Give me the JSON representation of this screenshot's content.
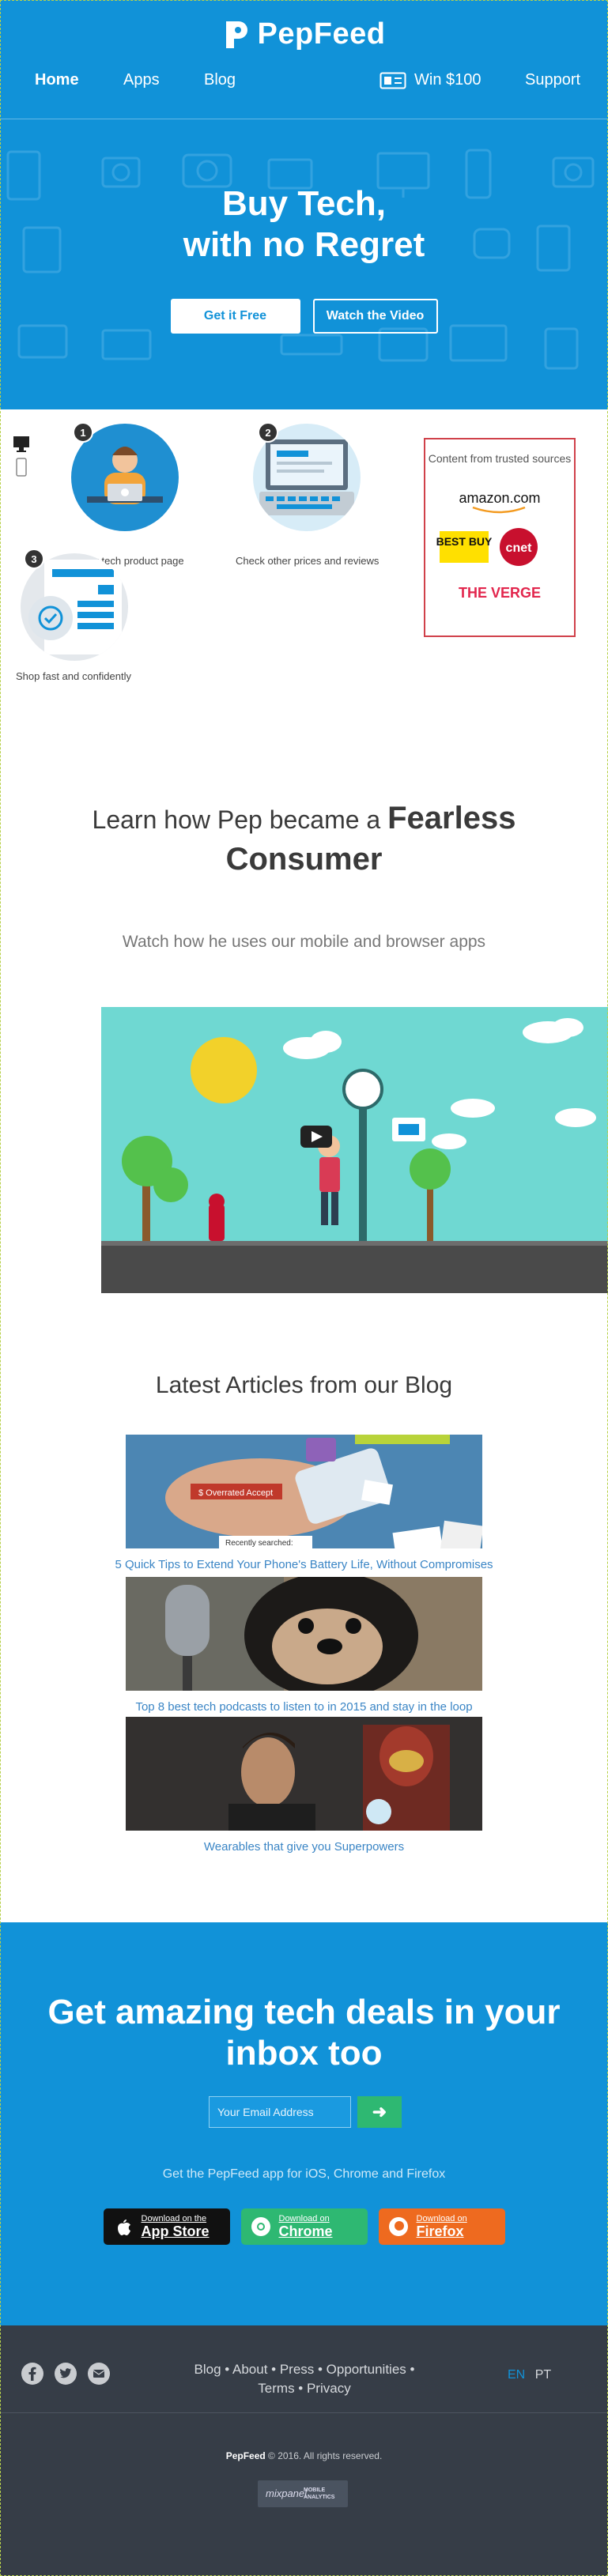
{
  "brand": {
    "name": "PepFeed"
  },
  "nav": {
    "home": "Home",
    "apps": "Apps",
    "blog": "Blog",
    "win": "Win $100",
    "support": "Support"
  },
  "hero": {
    "title_line1": "Buy Tech,",
    "title_line2": "with no Regret",
    "get_it_free": "Get it Free",
    "watch_video": "Watch the Video"
  },
  "how": {
    "steps": [
      {
        "num": "1",
        "label": "Visit any tech product page"
      },
      {
        "num": "2",
        "label": "Check other prices and reviews"
      },
      {
        "num": "3",
        "label": "Shop fast and confidently"
      }
    ],
    "sources_title": "Content from trusted sources",
    "sources": [
      "amazon.com",
      "BEST BUY",
      "cnet",
      "THE VERGE"
    ]
  },
  "learn": {
    "title_pre": "Learn how Pep became a",
    "title_strong1": "Fearless",
    "title_strong2": "Consumer",
    "subtitle": "Watch how he uses our mobile and browser apps"
  },
  "blog": {
    "title": "Latest Articles from our Blog",
    "articles": [
      {
        "title": "5 Quick Tips to Extend Your Phone's Battery Life, Without Compromises",
        "img_text1": "$ Overrated Accept",
        "img_text2": "Recently searched:"
      },
      {
        "title": "Top 8 best tech podcasts to listen to in 2015 and stay in the loop"
      },
      {
        "title": "Wearables that give you Superpowers"
      }
    ]
  },
  "newsletter": {
    "title_line1": "Get amazing tech deals in your",
    "title_line2": "inbox too",
    "email_placeholder": "Your Email Address",
    "submit_glyph": "➜",
    "apps_text": "Get the PepFeed app for iOS, Chrome and Firefox",
    "stores": [
      {
        "small": "Download on the",
        "big": "App Store"
      },
      {
        "small": "Download on",
        "big": "Chrome"
      },
      {
        "small": "Download on",
        "big": "Firefox"
      }
    ]
  },
  "footer": {
    "links_line1": "Blog • About • Press • Opportunities •",
    "links_line2": "Terms • Privacy",
    "lang_en": "EN",
    "lang_pt": "PT",
    "copyright_brand": "PepFeed",
    "copyright_rest": " © 2016. All rights reserved.",
    "mixpanel_logo": "mixpanel",
    "mixpanel_line1": "MOBILE",
    "mixpanel_line2": "ANALYTICS"
  },
  "colors": {
    "primary_blue": "#1192d8",
    "green": "#2eb872",
    "orange": "#ee6a1f",
    "footer_bg": "#363d47",
    "link_blue": "#3a85c5",
    "sources_border": "#d0414a"
  }
}
